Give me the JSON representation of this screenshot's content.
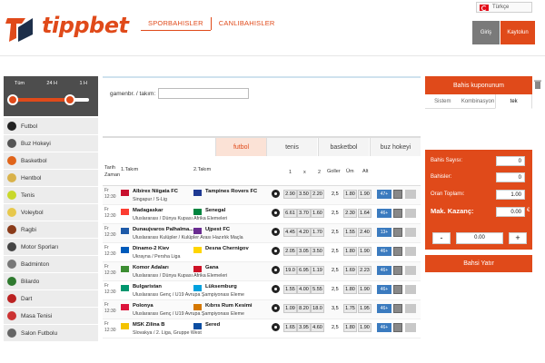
{
  "brand": {
    "logo_text": "tippbet"
  },
  "topnav": {
    "items": [
      "SPORBAHISLER",
      "CANLIBAHISLER"
    ]
  },
  "language": {
    "selected": "Türkçe"
  },
  "auth": {
    "login": "Giriş",
    "register": "Kaytolun"
  },
  "odds_filter": {
    "labels": [
      "Tüm",
      "24 H",
      "1 H"
    ],
    "range_start": 0.0,
    "range_end": 0.75
  },
  "sports": [
    {
      "label": "Futbol",
      "icon": "football-icon",
      "color": "#222"
    },
    {
      "label": "Buz Hokeyi",
      "icon": "ice-hockey-icon",
      "color": "#555"
    },
    {
      "label": "Basketbol",
      "icon": "basketball-icon",
      "color": "#e0641a"
    },
    {
      "label": "Hentbol",
      "icon": "handball-icon",
      "color": "#d9b24a"
    },
    {
      "label": "Tenis",
      "icon": "tennis-icon",
      "color": "#c8d82a"
    },
    {
      "label": "Voleybol",
      "icon": "volleyball-icon",
      "color": "#e7c84c"
    },
    {
      "label": "Ragbi",
      "icon": "rugby-icon",
      "color": "#8a3b1a"
    },
    {
      "label": "Motor Sporları",
      "icon": "motorsport-icon",
      "color": "#444"
    },
    {
      "label": "Badminton",
      "icon": "badminton-icon",
      "color": "#777"
    },
    {
      "label": "Bilardo",
      "icon": "billiards-icon",
      "color": "#2f7a2f"
    },
    {
      "label": "Dart",
      "icon": "dart-icon",
      "color": "#b22"
    },
    {
      "label": "Masa Tenisi",
      "icon": "table-tennis-icon",
      "color": "#c33"
    },
    {
      "label": "Salon Futbolu",
      "icon": "futsal-icon",
      "color": "#666"
    }
  ],
  "search": {
    "label": "gamenbr. / takım:",
    "value": ""
  },
  "sport_tabs": {
    "items": [
      "futbol",
      "tenis",
      "basketbol",
      "buz hokeyi"
    ],
    "active": 0
  },
  "table": {
    "headers": {
      "date_time": "Tarih Zaman",
      "team1": "1.Takım",
      "team2": "2.Takım",
      "one": "1",
      "x": "x",
      "two": "2",
      "goals": "Goller",
      "over": "Üm",
      "under": "Alt"
    },
    "rows": [
      {
        "day": "Fr",
        "time": "12:30",
        "team1": "Albirex Niigata FC",
        "team2": "Tampines Rovers FC",
        "league": "Singapur  /  S-Lig",
        "o1": "2.90",
        "ox": "3.50",
        "o2": "2.20",
        "goals": "2,5",
        "over": "1.80",
        "under": "1.90",
        "more": "47+",
        "flag1": "#c8102e",
        "flag2": "#1f3a93"
      },
      {
        "day": "Fr",
        "time": "12:30",
        "team1": "Madagaskar",
        "team2": "Senegal",
        "league": "Uluslararası  /  Dünya Kupası Afrika Elemeleri",
        "o1": "6.61",
        "ox": "3.70",
        "o2": "1.60",
        "goals": "2,5",
        "over": "2.30",
        "under": "1.64",
        "more": "46+",
        "flag1": "#fc3d32",
        "flag2": "#00853f"
      },
      {
        "day": "Fr",
        "time": "12:30",
        "team1": "Dunaujvaros Palhalma...",
        "team2": "Ujpest FC",
        "league": "Uluslararası Kulüpler  /  Kulüpler Arası Hazırlık Maçla",
        "o1": "4.45",
        "ox": "4.20",
        "o2": "1.70",
        "goals": "2,5",
        "over": "1.55",
        "under": "2.40",
        "more": "13+",
        "flag1": "#1e5aa8",
        "flag2": "#6a2c91"
      },
      {
        "day": "Fr",
        "time": "12:30",
        "team1": "Dinamo-2 Kiev",
        "team2": "Desna Chernigov",
        "league": "Ukrayna  /  Persha Liga",
        "o1": "2.05",
        "ox": "3.05",
        "o2": "3.50",
        "goals": "2,5",
        "over": "1.80",
        "under": "1.90",
        "more": "46+",
        "flag1": "#005bbb",
        "flag2": "#ffd500"
      },
      {
        "day": "Fr",
        "time": "12:30",
        "team1": "Komor Adaları",
        "team2": "Gana",
        "league": "Uluslararası  /  Dünya Kupası Afrika Elemeleri",
        "o1": "19.0",
        "ox": "6.95",
        "o2": "1.19",
        "goals": "2,5",
        "over": "1.69",
        "under": "2.23",
        "more": "46+",
        "flag1": "#3d8e33",
        "flag2": "#ce1126"
      },
      {
        "day": "Fr",
        "time": "12:30",
        "team1": "Bulgaristan",
        "team2": "Lüksemburg",
        "league": "Uluslararası Genç  /  U19 Avrupa Şampiyonası Eleme",
        "o1": "1.55",
        "ox": "4.00",
        "o2": "5.55",
        "goals": "2,5",
        "over": "1.80",
        "under": "1.90",
        "more": "46+",
        "flag1": "#00966e",
        "flag2": "#00a1de"
      },
      {
        "day": "Fr",
        "time": "12:30",
        "team1": "Polonya",
        "team2": "Kıbrıs Rum Kesimi",
        "league": "Uluslararası Genç  /  U19 Avrupa Şampiyonası Eleme",
        "o1": "1.09",
        "ox": "8.20",
        "o2": "18.0",
        "goals": "3,5",
        "over": "1.75",
        "under": "1.95",
        "more": "46+",
        "flag1": "#dc143c",
        "flag2": "#d57800"
      },
      {
        "day": "Fr",
        "time": "12:30",
        "team1": "MSK Zilina B",
        "team2": "Sered",
        "league": "Slovakya  /  2. Liga, Gruppe West",
        "o1": "1.65",
        "ox": "3.95",
        "o2": "4.60",
        "goals": "2,5",
        "over": "1.80",
        "under": "1.90",
        "more": "46+",
        "flag1": "#f4c300",
        "flag2": "#0b4ea2"
      }
    ]
  },
  "coupon": {
    "title": "Bahis kuponunum",
    "tabs": [
      "Sistem",
      "Kombinasyon",
      "tek"
    ],
    "active_tab": 2,
    "fields": [
      {
        "label": "Bahis Sayısı:",
        "value": "0"
      },
      {
        "label": "Bahisler:",
        "value": "0"
      },
      {
        "label": "Oran Toplamı:",
        "value": "1.00"
      }
    ],
    "max_win": {
      "label": "Mak. Kazanç:",
      "value": "0.00",
      "currency": "€"
    },
    "stake": {
      "minus": "-",
      "plus": "+",
      "value": "0.00"
    },
    "submit": "Bahsi Yatır"
  }
}
